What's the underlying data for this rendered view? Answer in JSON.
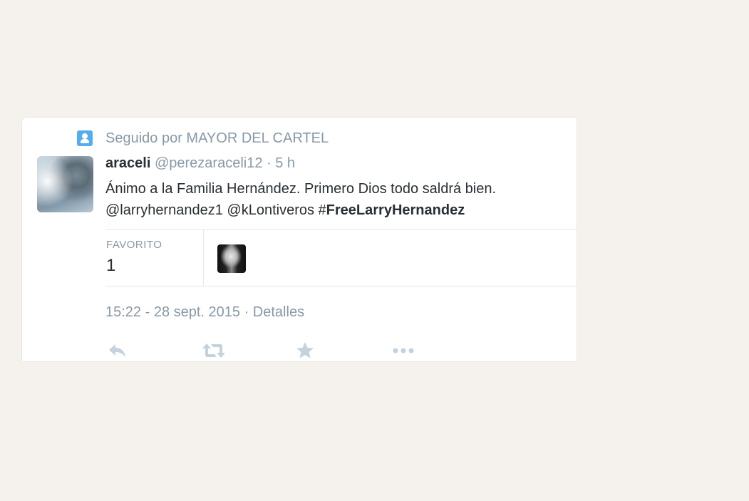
{
  "followed_by": {
    "text": "Seguido por MAYOR DEL CARTEL"
  },
  "tweet": {
    "name": "araceli",
    "handle": "@perezaraceli12",
    "separator": "·",
    "time": "5 h",
    "line1": "Ánimo a la Familia Hernández. Primero Dios todo saldrá bien.",
    "mention1": "@larryhernandez1",
    "mention2": "@kLontiveros",
    "hash_symbol": "#",
    "hashtag": "FreeLarryHernandez"
  },
  "stats": {
    "favorites_label": "FAVORITO",
    "favorites_count": "1"
  },
  "meta": {
    "datetime": "15:22 - 28 sept. 2015 · Detalles"
  },
  "icons": {
    "follow": "person-icon",
    "reply": "reply-icon",
    "retweet": "retweet-icon",
    "favorite": "star-icon",
    "more": "more-icon"
  },
  "colors": {
    "page_bg": "#f5f2ee",
    "muted_text": "#8899a6",
    "body_text": "#292f33",
    "accent": "#55acee",
    "action_icon": "#c4d2dd"
  }
}
